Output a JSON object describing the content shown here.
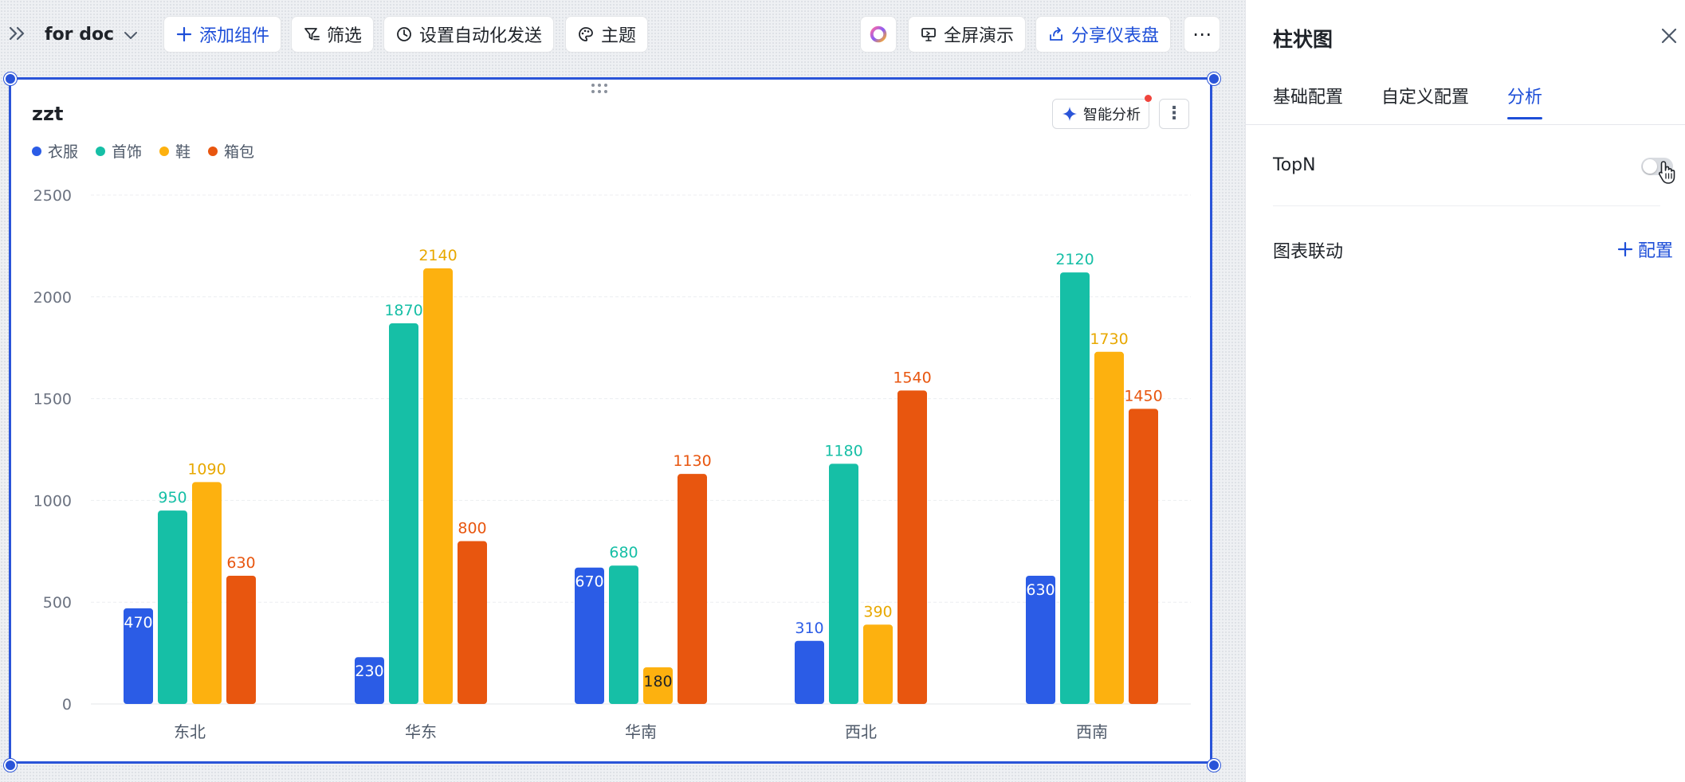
{
  "toolbar": {
    "doc_title": "for doc",
    "add_widget": "添加组件",
    "filter": "筛选",
    "auto_send": "设置自动化发送",
    "theme": "主题",
    "fullscreen": "全屏演示",
    "share": "分享仪表盘",
    "more": "⋯"
  },
  "card": {
    "title": "zzt",
    "ai_analysis": "智能分析",
    "more": "⋮"
  },
  "panel": {
    "title": "柱状图",
    "tabs": [
      {
        "label": "基础配置"
      },
      {
        "label": "自定义配置"
      },
      {
        "label": "分析"
      }
    ],
    "topn_label": "TopN",
    "topn_enabled": false,
    "linkage_label": "图表联动",
    "config_label": "配置"
  },
  "colors": {
    "accent": "#1d4ed8",
    "series": [
      "#2b5ce6",
      "#16bfa6",
      "#fdb10f",
      "#e8560f"
    ],
    "label_colors": [
      "#2b5ce6",
      "#16bfa6",
      "#e8a800",
      "#e8560f"
    ]
  },
  "chart_data": {
    "type": "bar",
    "title": "zzt",
    "categories": [
      "东北",
      "华东",
      "华南",
      "西北",
      "西南"
    ],
    "series": [
      {
        "name": "衣服",
        "values": [
          470,
          230,
          670,
          310,
          630
        ]
      },
      {
        "name": "首饰",
        "values": [
          950,
          1870,
          680,
          1180,
          2120
        ]
      },
      {
        "name": "鞋",
        "values": [
          1090,
          2140,
          180,
          390,
          1730
        ]
      },
      {
        "name": "箱包",
        "values": [
          630,
          800,
          1130,
          1540,
          1450
        ]
      }
    ],
    "yticks": [
      0,
      500,
      1000,
      1500,
      2000,
      2500
    ],
    "ylim": [
      0,
      2500
    ],
    "grid": true,
    "legend": "top-left",
    "data_labels": true
  }
}
